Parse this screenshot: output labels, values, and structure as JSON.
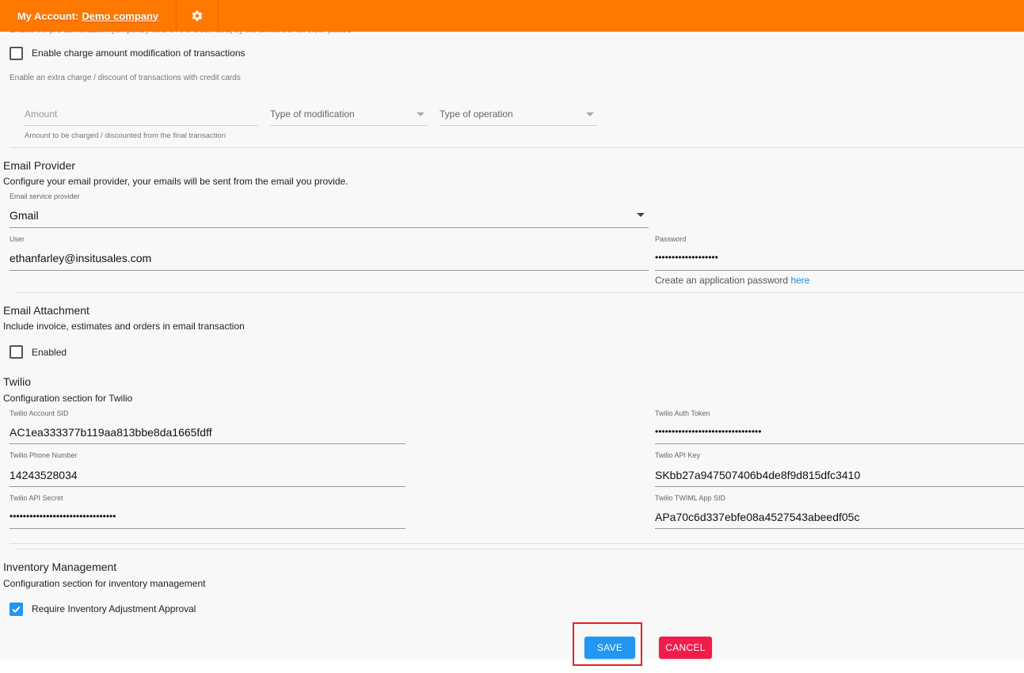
{
  "header": {
    "account_prefix": "My Account:",
    "company": "Demo company",
    "settings_icon": "gear-icon"
  },
  "preauth": {
    "cut_text": "Enable the pre-authorization (temporary hold on the credit card) by the amount of an order placed"
  },
  "charge_mod": {
    "label": "Enable charge amount modification of transactions",
    "checked": false,
    "hint": "Enable an extra charge / discount of transactions with credit cards",
    "amount_placeholder": "Amount",
    "amount_hint": "Amount to be charged / discounted from the final transaction",
    "type_mod_placeholder": "Type of modification",
    "type_op_placeholder": "Type of operation"
  },
  "email_provider": {
    "title": "Email Provider",
    "subtitle": "Configure your email provider, your emails will be sent from the email you provide.",
    "provider_label": "Email service provider",
    "provider_value": "Gmail",
    "user_label": "User",
    "user_value": "ethanfarley@insitusales.com",
    "password_label": "Password",
    "password_value": "•••••••••••••••••••",
    "password_hint": "Create an application password",
    "password_hint_link": "here"
  },
  "email_attachment": {
    "title": "Email Attachment",
    "subtitle": "Include invoice, estimates and orders in email transaction",
    "enabled_label": "Enabled",
    "checked": false
  },
  "twilio": {
    "title": "Twilio",
    "subtitle": "Configuration section for Twilio",
    "account_sid_label": "Twilio Account SID",
    "account_sid_value": "AC1ea333377b119aa813bbe8da1665fdff",
    "auth_token_label": "Twilio Auth Token",
    "auth_token_value": "••••••••••••••••••••••••••••••••",
    "phone_label": "Twilio Phone Number",
    "phone_value": "14243528034",
    "api_key_label": "Twilio API Key",
    "api_key_value": "SKbb27a947507406b4de8f9d815dfc3410",
    "api_secret_label": "Twilio API Secret",
    "api_secret_value": "••••••••••••••••••••••••••••••••",
    "twiml_label": "Twilio TWIML App SID",
    "twiml_value": "APa70c6d337ebfe08a4527543abeedf05c"
  },
  "inventory": {
    "title": "Inventory Management",
    "subtitle": "Configuration section for inventory management",
    "approval_label": "Require Inventory Adjustment Approval",
    "checked": true
  },
  "actions": {
    "save": "SAVE",
    "cancel": "CANCEL"
  },
  "colors": {
    "header_bg": "#ff7800",
    "save_bg": "#2196f3",
    "cancel_bg": "#f21b4a",
    "checkbox_on": "#2196f3",
    "link": "#1e88e5",
    "highlight": "#e02424"
  }
}
